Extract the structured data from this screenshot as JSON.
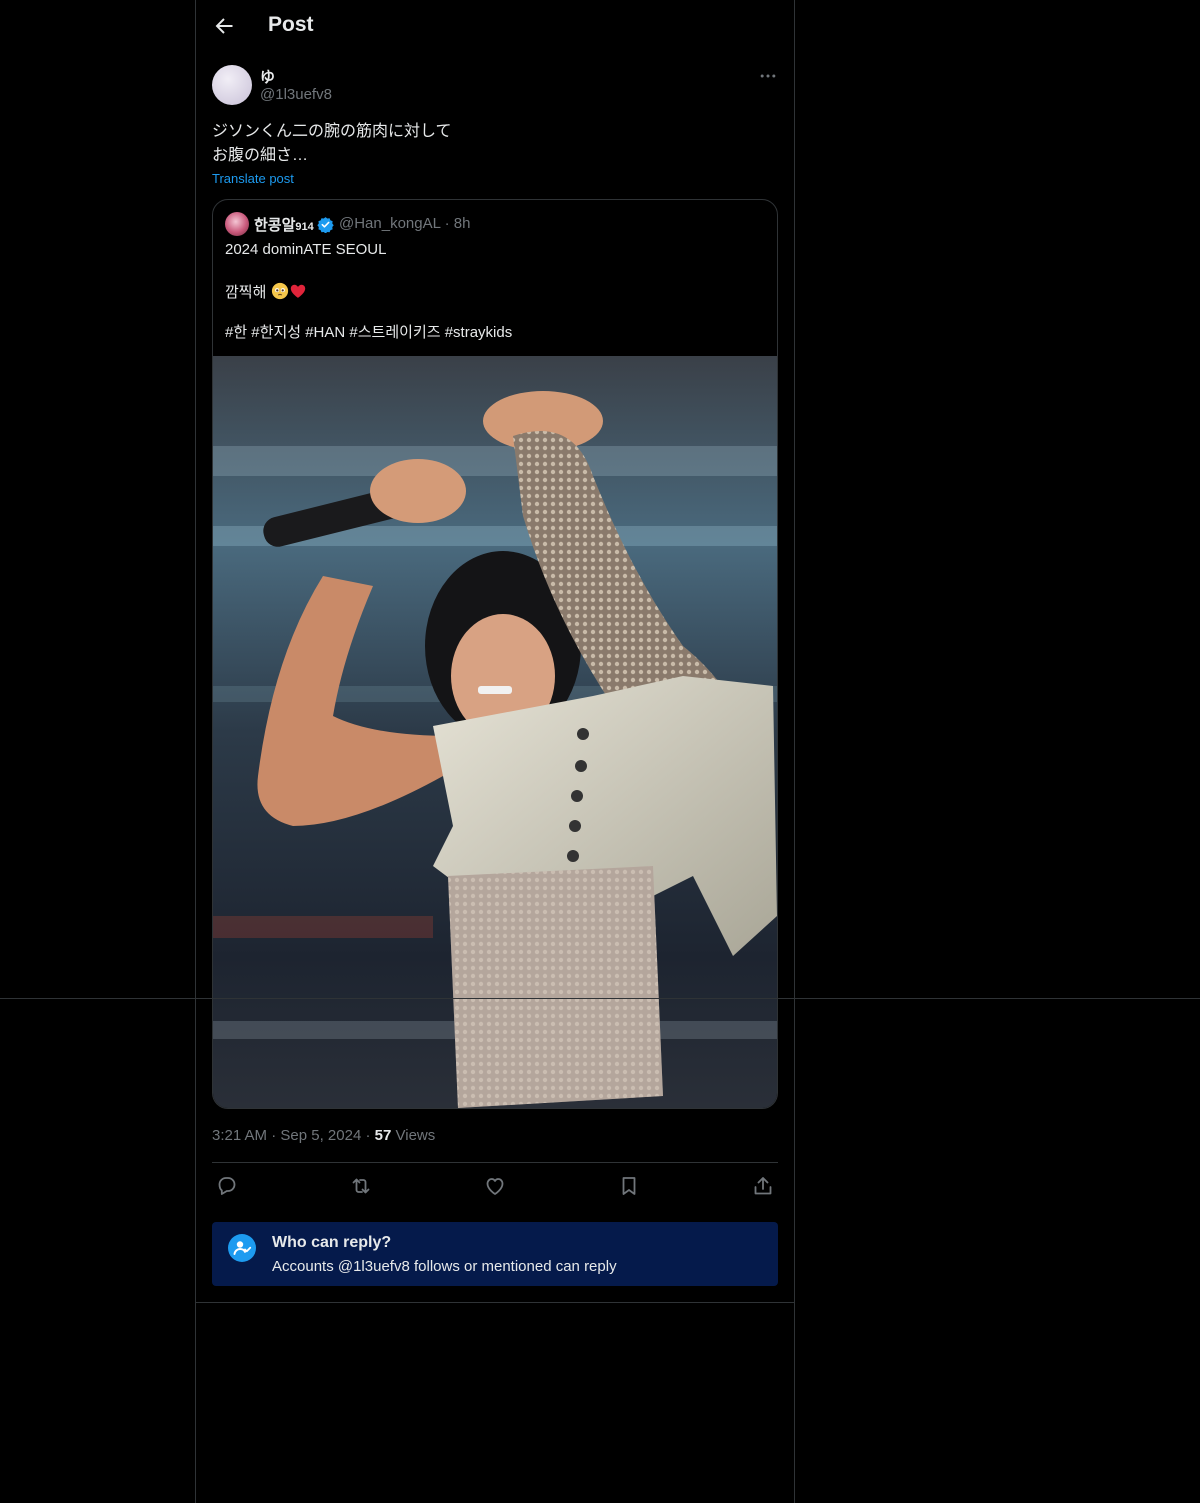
{
  "header": {
    "title": "Post",
    "back_icon": "arrow-left-icon"
  },
  "post": {
    "author_name": "ゆ",
    "author_handle": "@1l3uefv8",
    "text_lines": [
      "ジソンくん二の腕の筋肉に対して",
      "お腹の細さ…"
    ],
    "translate_label": "Translate post",
    "timestamp_time": "3:21 AM",
    "timestamp_date": "Sep 5, 2024",
    "views_count": "57",
    "views_label": "Views"
  },
  "quote": {
    "author_name": "한콩알",
    "author_name_suffix": "914",
    "author_handle": "@Han_kongAL",
    "time_ago": "8h",
    "line1": "2024 dominATE SEOUL",
    "line2": "깜찍해",
    "hashtags": "#한 #한지성 #HAN #스트레이키즈 #straykids",
    "verified_color": "#1d9bf0"
  },
  "actions": [
    "reply-icon",
    "repost-icon",
    "like-icon",
    "bookmark-icon",
    "share-icon"
  ],
  "who_can_reply": {
    "title": "Who can reply?",
    "subtitle": "Accounts @1l3uefv8 follows or mentioned can reply"
  },
  "colors": {
    "background": "#000000",
    "border": "#2f3336",
    "accent": "#1d9bf0",
    "muted": "#71767b",
    "banner": "#051a4b"
  }
}
